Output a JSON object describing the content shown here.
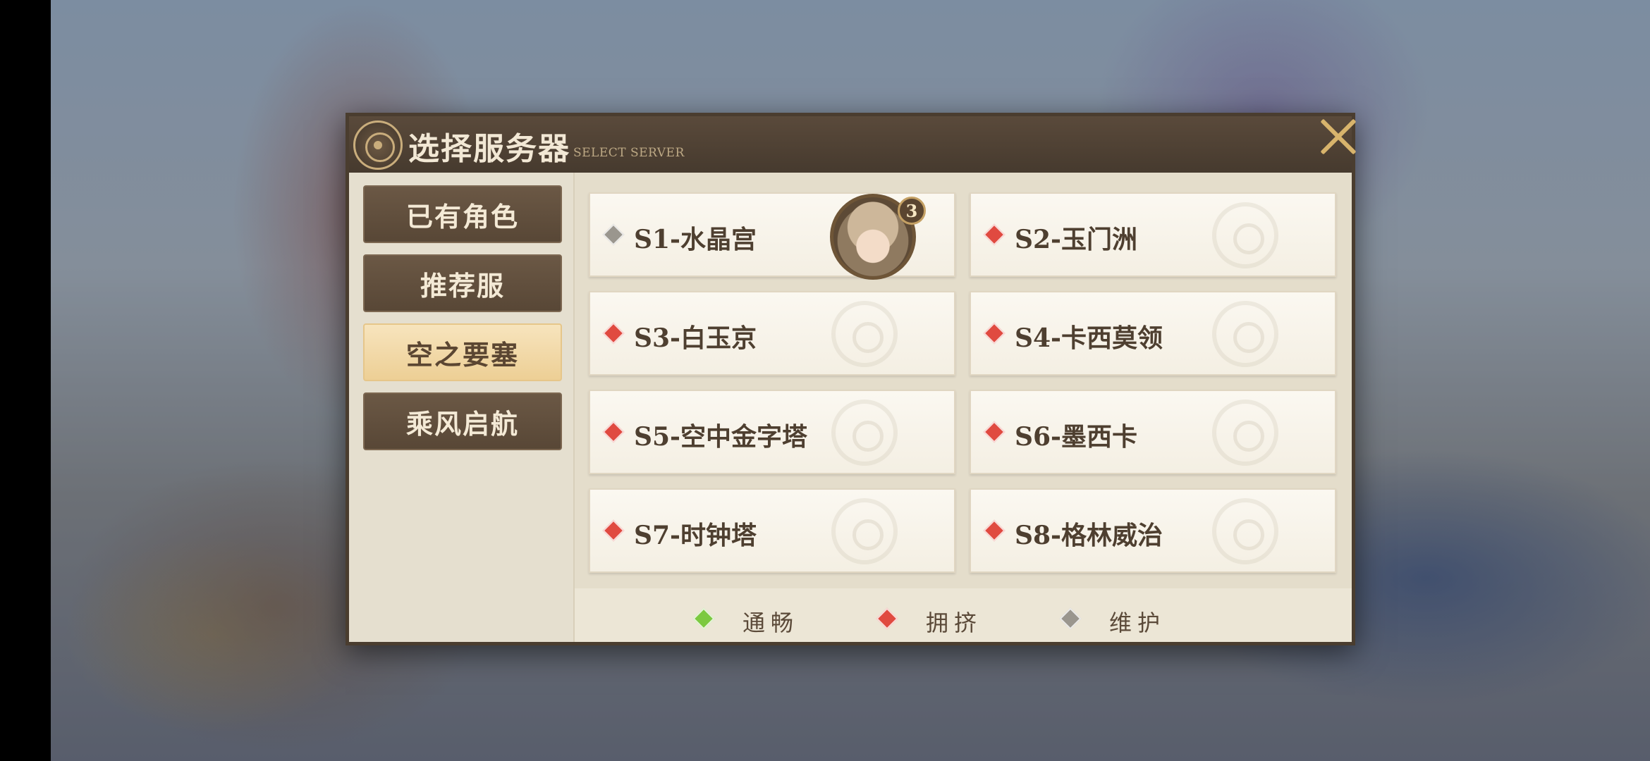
{
  "header": {
    "title": "选择服务器",
    "subtitle": "SELECT SERVER"
  },
  "sidebar": {
    "tabs": [
      {
        "label": "已有角色",
        "active": false
      },
      {
        "label": "推荐服",
        "active": false
      },
      {
        "label": "空之要塞",
        "active": true
      },
      {
        "label": "乘风启航",
        "active": false
      }
    ]
  },
  "servers": [
    {
      "name": "S1-水晶宫",
      "status": "maintenance",
      "character_count": "3"
    },
    {
      "name": "S2-玉门洲",
      "status": "crowded"
    },
    {
      "name": "S3-白玉京",
      "status": "crowded"
    },
    {
      "name": "S4-卡西莫领",
      "status": "crowded"
    },
    {
      "name": "S5-空中金字塔",
      "status": "crowded"
    },
    {
      "name": "S6-墨西卡",
      "status": "crowded"
    },
    {
      "name": "S7-时钟塔",
      "status": "crowded"
    },
    {
      "name": "S8-格林威治",
      "status": "crowded"
    }
  ],
  "legend": [
    {
      "label": "通畅",
      "status": "smooth",
      "color": "#7cc940"
    },
    {
      "label": "拥挤",
      "status": "crowded",
      "color": "#e04a40"
    },
    {
      "label": "维护",
      "status": "maintenance",
      "color": "#9a968e"
    }
  ],
  "status_colors": {
    "smooth": "#7cc940",
    "crowded": "#e04a40",
    "maintenance": "#9a968e"
  },
  "icons": {
    "header_emblem": "gear-emblem-icon",
    "close": "close-icon",
    "status": "diamond-status-icon"
  }
}
